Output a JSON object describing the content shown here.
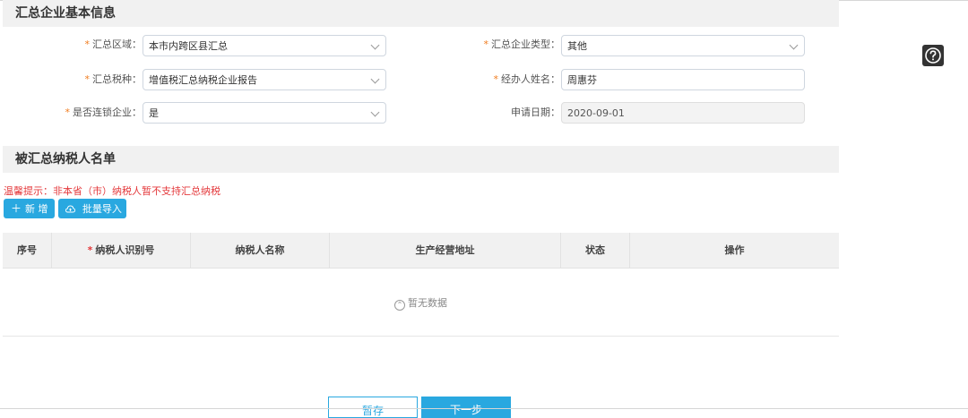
{
  "section_basic": {
    "title": "汇总企业基本信息"
  },
  "form": {
    "region": {
      "label": "汇总区域：",
      "value": "本市内跨区县汇总"
    },
    "enterprise_type": {
      "label": "汇总企业类型：",
      "value": "其他"
    },
    "tax_type": {
      "label": "汇总税种：",
      "value": "增值税汇总纳税企业报告"
    },
    "operator": {
      "label": "经办人姓名：",
      "value": "周惠芬"
    },
    "chain": {
      "label": "是否连锁企业：",
      "value": "是"
    },
    "apply_date": {
      "label": "申请日期：",
      "value": "2020-09-01"
    }
  },
  "section_list": {
    "title": "被汇总纳税人名单"
  },
  "tip": "温馨提示：非本省（市）纳税人暂不支持汇总纳税",
  "actions": {
    "add": "新 增",
    "import": "批量导入"
  },
  "table": {
    "columns": [
      "序号",
      "纳税人识别号",
      "纳税人名称",
      "生产经营地址",
      "状态",
      "操作"
    ],
    "empty_text": "暂无数据"
  },
  "footer": {
    "save": "暂存",
    "next": "下一步"
  },
  "colors": {
    "accent": "#29a8e0",
    "required": "#f07c1e",
    "warning": "#e4393c"
  }
}
